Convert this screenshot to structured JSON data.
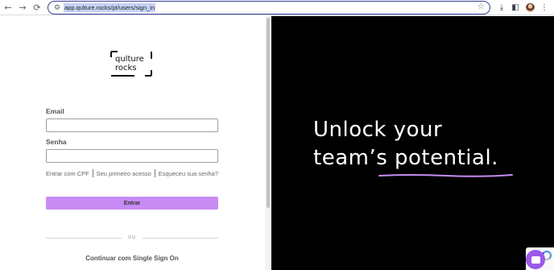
{
  "browser": {
    "url": "app.qulture.rocks/pt/users/sign_in",
    "icons": [
      "back-arrow-icon",
      "forward-arrow-icon",
      "reload-icon",
      "site-settings-icon",
      "bookmark-star-icon",
      "download-icon",
      "side-panel-icon",
      "profile-avatar",
      "menu-kebab-icon"
    ]
  },
  "logo": {
    "line1": "qulture",
    "line2": "rocks"
  },
  "form": {
    "email_label": "Email",
    "email_value": "",
    "password_label": "Senha",
    "password_value": "",
    "links": [
      "Entrar com CPF",
      "Seu primeiro acesso",
      "Esqueceu sua senha?"
    ],
    "submit_label": "Entrar",
    "divider_text": "ou",
    "sso_label": "Continuar com Single Sign On"
  },
  "hero": {
    "line1": "Unlock your",
    "line2": "team’s potential.",
    "background": "#000000",
    "text_color": "#ffffff",
    "accent": "#c78bf4"
  },
  "colors": {
    "primary_button": "#c78bf4",
    "url_highlight": "#c6d3f5",
    "omnibox_border": "#3a3f9a"
  }
}
